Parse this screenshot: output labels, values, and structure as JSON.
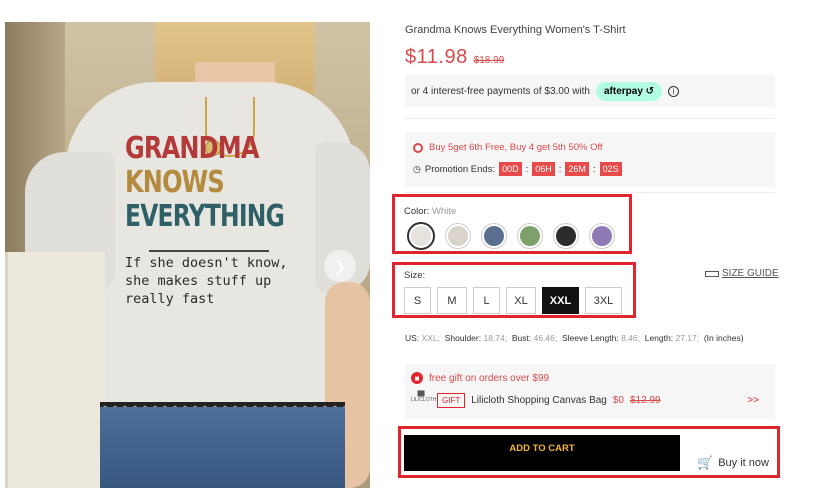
{
  "photo": {
    "print_line1": "GRANDMA",
    "print_line2": "KNOWS",
    "print_line3": "EVERYTHING",
    "print_small1": "If she doesn't know,",
    "print_small2": "she makes stuff up",
    "print_small3": "really fast",
    "next_icon": "chevron-right-icon"
  },
  "product": {
    "title": "Grandma Knows Everything Women's T-Shirt",
    "price": "$11.98",
    "old_price": "$18.99"
  },
  "afterpay": {
    "text": "or 4 interest-free payments of $3.00 with",
    "badge": "afterpay",
    "badge_symbol": "↺",
    "info": "i"
  },
  "promo": {
    "offer": "Buy 5get 6th Free, Buy 4 get 5th 50% Off",
    "ends_label": "Promotion Ends:",
    "days": "00D",
    "hours": "06H",
    "minutes": "26M",
    "seconds": "02S",
    "sep": ":"
  },
  "color": {
    "label": "Color:",
    "selected": "White",
    "swatches": [
      "#e6e2dc",
      "#d9d3cc",
      "#5a6f8f",
      "#7ea06a",
      "#2c2c2c",
      "#8f7ab8"
    ]
  },
  "size": {
    "label": "Size:",
    "guide": "SIZE GUIDE",
    "options": [
      "S",
      "M",
      "L",
      "XL",
      "XXL",
      "3XL"
    ],
    "selected": "XXL"
  },
  "measurements": {
    "us_label": "US:",
    "us_value": "XXL;",
    "shoulder_label": "Shoulder:",
    "shoulder_value": "18.74;",
    "bust_label": "Bust:",
    "bust_value": "46.46;",
    "sleeve_label": "Sleeve Length:",
    "sleeve_value": "8.46;",
    "length_label": "Length:",
    "length_value": "27.17;",
    "unit": "(In inches)"
  },
  "gift": {
    "headline": "free gift on orders over $99",
    "brand": "LILICLOTH",
    "tag": "GIFT",
    "name": "Lilicloth Shopping Canvas Bag",
    "price": "$0",
    "old_price": "$12.99",
    "more": ">>"
  },
  "actions": {
    "add_to_cart": "ADD TO CART",
    "buy_now": "Buy it now"
  }
}
